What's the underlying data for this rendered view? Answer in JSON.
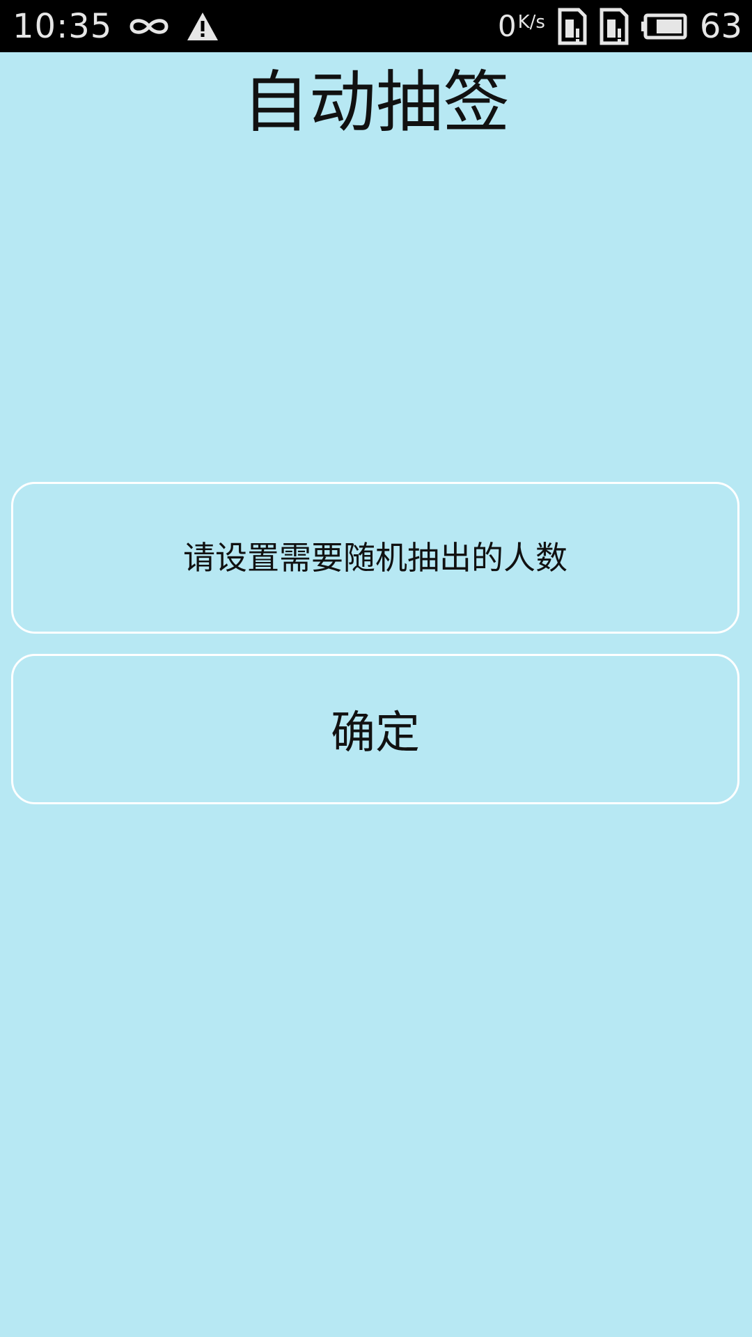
{
  "status_bar": {
    "time": "10:35",
    "net_speed_value": "0",
    "net_speed_unit": "K/s",
    "battery_level": "63",
    "icons": [
      "infinity-icon",
      "warning-icon",
      "sim-card-icon",
      "sim-card-icon",
      "battery-icon"
    ]
  },
  "main": {
    "title": "自动抽签",
    "count_input_placeholder": "请设置需要随机抽出的人数",
    "count_input_value": "",
    "confirm_label": "确定"
  },
  "colors": {
    "background": "#b7e8f3",
    "status_bar": "#000000",
    "border": "#ffffff",
    "text": "#111111"
  }
}
